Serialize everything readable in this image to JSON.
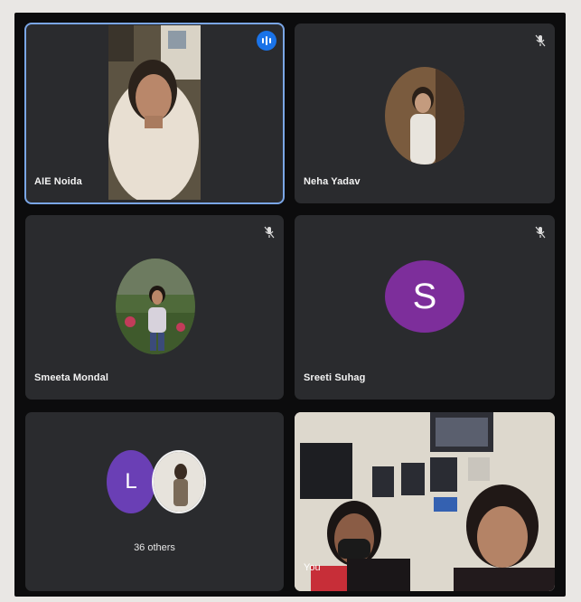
{
  "participants": [
    {
      "name": "AIE Noida",
      "state": "speaking",
      "icon": "audio-wave-icon"
    },
    {
      "name": "Neha Yadav",
      "state": "muted",
      "icon": "mic-off-icon"
    },
    {
      "name": "Smeeta Mondal",
      "state": "muted",
      "icon": "mic-off-icon"
    },
    {
      "name": "Sreeti Suhag",
      "state": "muted",
      "icon": "mic-off-icon",
      "avatar_letter": "S",
      "avatar_color": "#7d2e9b"
    }
  ],
  "others": {
    "count_label": "36 others",
    "avatar_letter": "L",
    "avatar_color": "#6a3fb5"
  },
  "self": {
    "label": "You"
  },
  "colors": {
    "active_outline": "#7aa6e6",
    "tile_bg": "#2a2b2e",
    "speaking_badge": "#1a73e8"
  }
}
